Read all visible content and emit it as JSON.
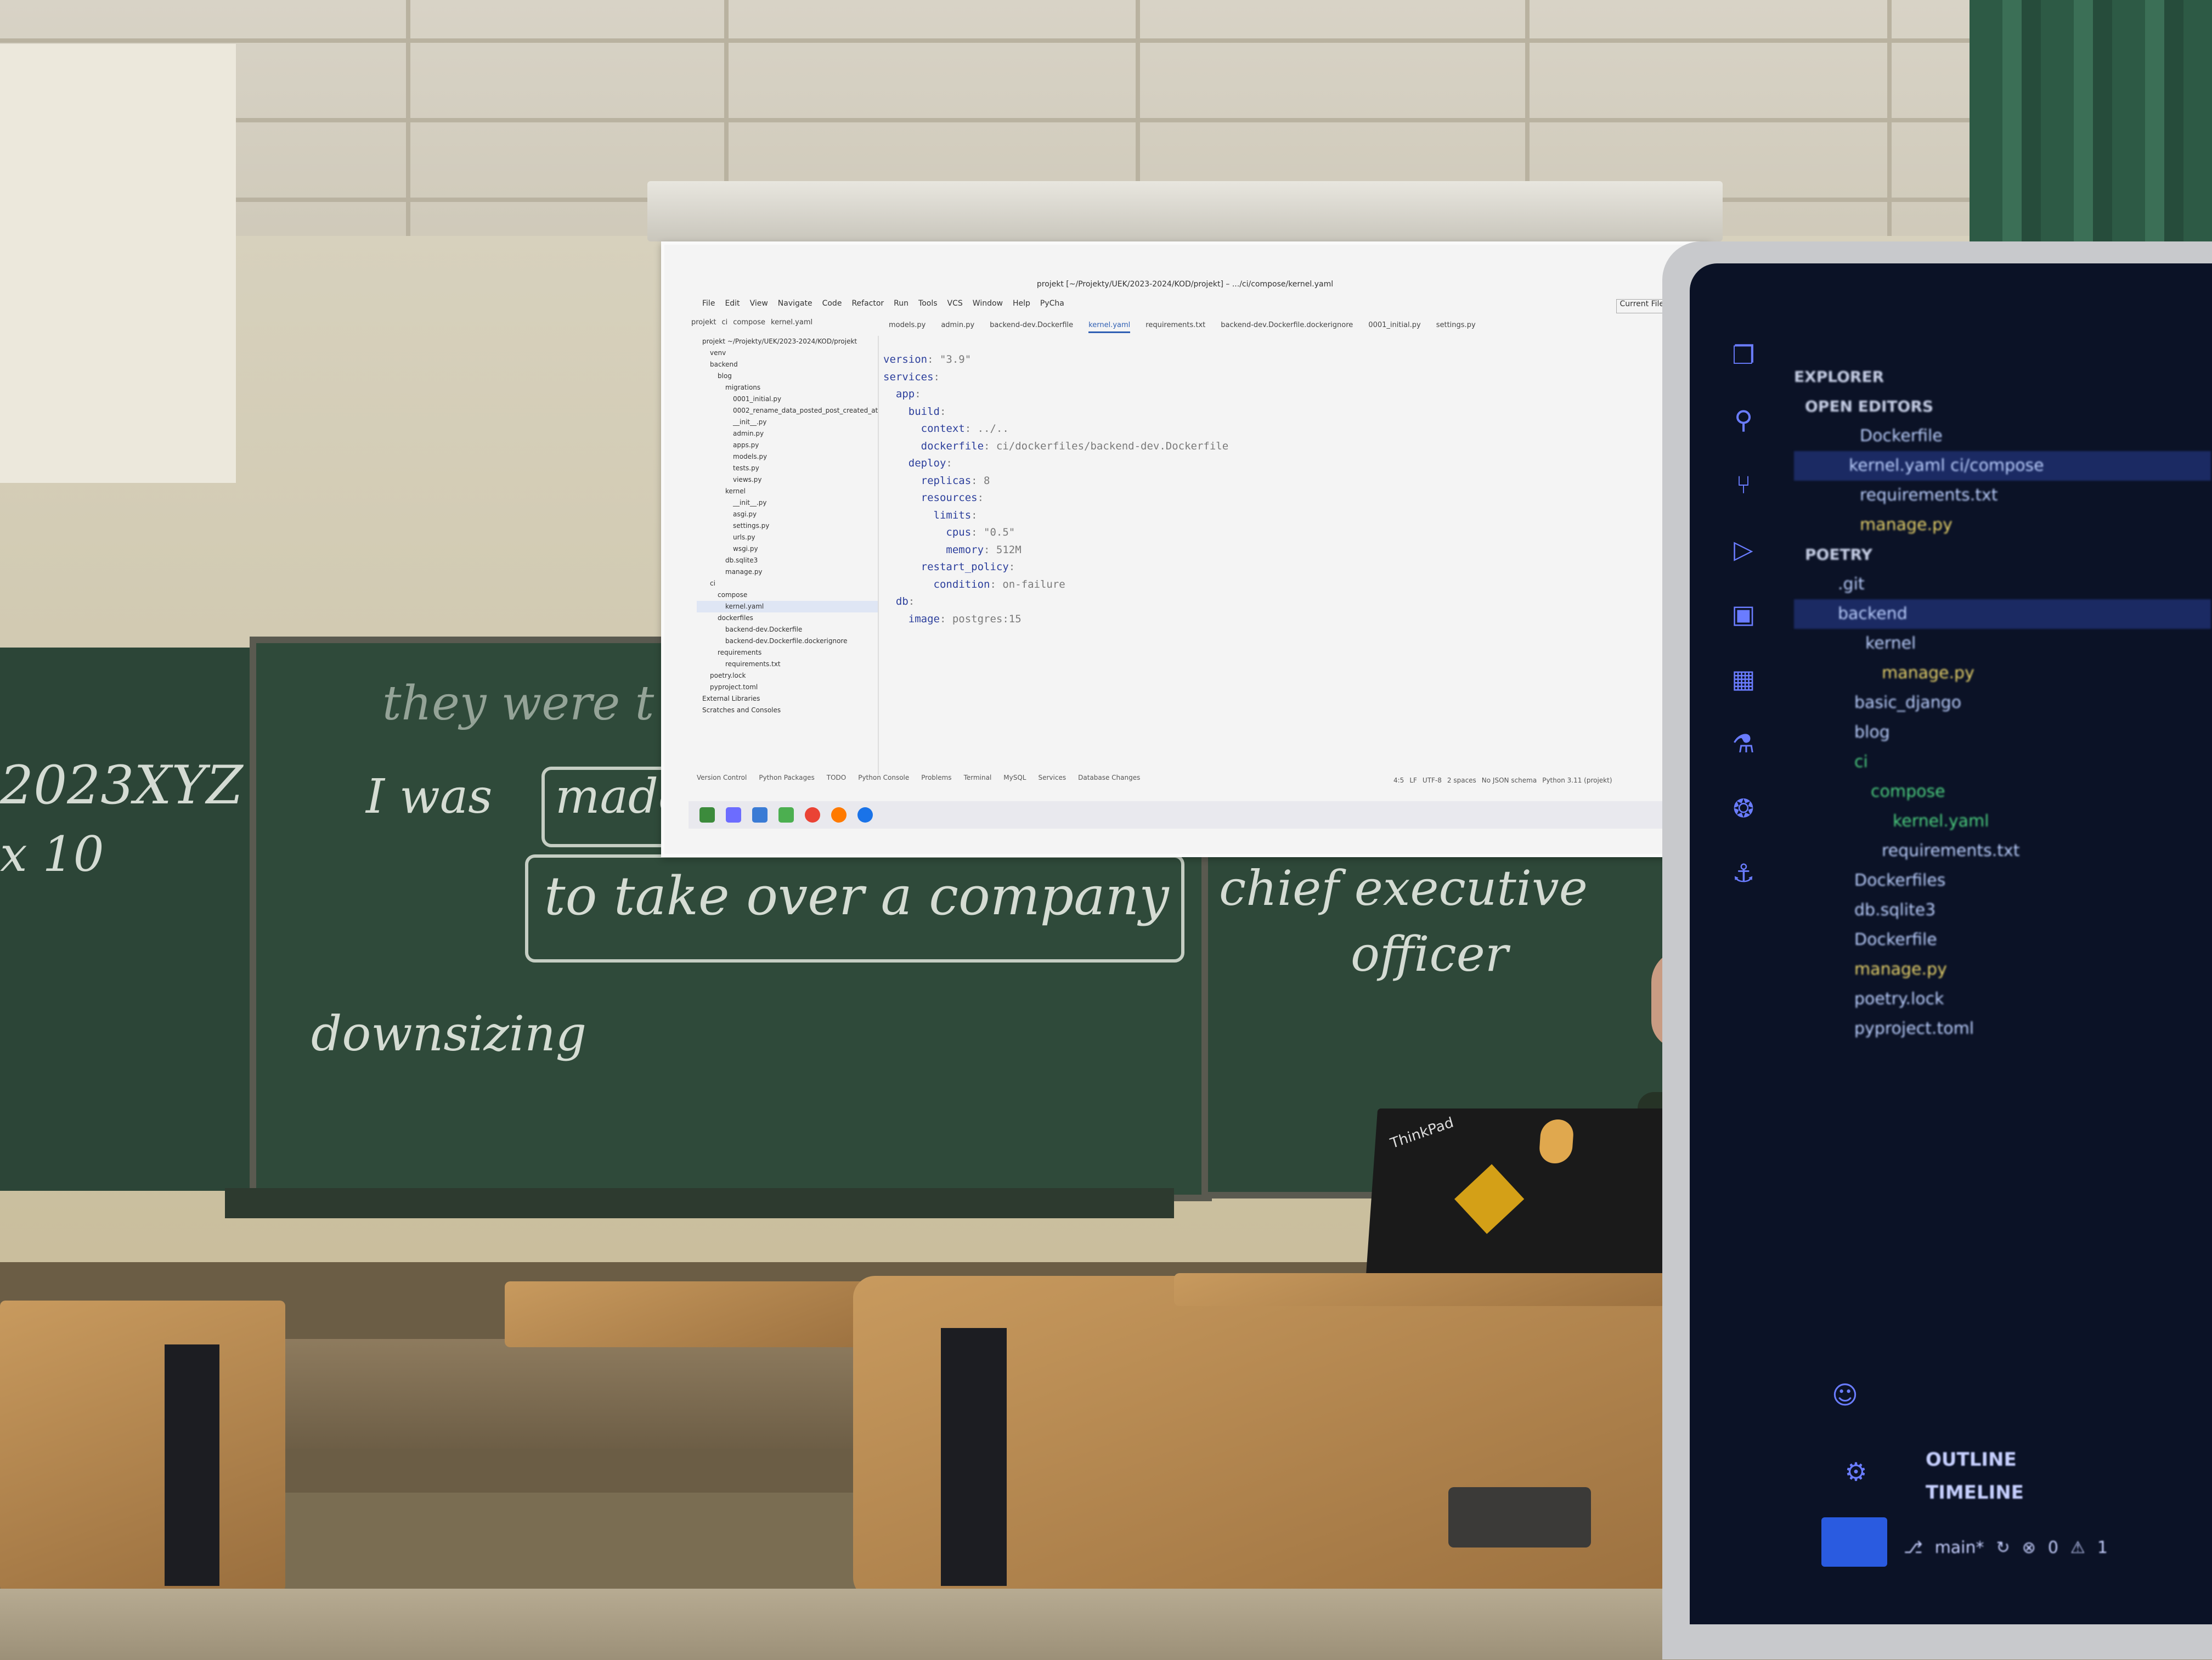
{
  "ide": {
    "title": "projekt [~/Projekty/UEK/2023-2024/KOD/projekt] – .../ci/compose/kernel.yaml",
    "menu": [
      "File",
      "Edit",
      "View",
      "Navigate",
      "Code",
      "Refactor",
      "Run",
      "Tools",
      "VCS",
      "Window",
      "Help",
      "PyCha"
    ],
    "breadcrumb": [
      "projekt",
      "ci",
      "compose",
      "kernel.yaml"
    ],
    "run_config": "Current File",
    "tabs": [
      "models.py",
      "admin.py",
      "backend-dev.Dockerfile",
      "kernel.yaml",
      "requirements.txt",
      "backend-dev.Dockerfile.dockerignore",
      "0001_initial.py",
      "settings.py"
    ],
    "active_tab": "kernel.yaml",
    "project_tree": [
      "projekt  ~/Projekty/UEK/2023-2024/KOD/projekt",
      "venv",
      "backend",
      "blog",
      "migrations",
      "0001_initial.py",
      "0002_rename_data_posted_post_created_at",
      "__init__.py",
      "admin.py",
      "apps.py",
      "models.py",
      "tests.py",
      "views.py",
      "kernel",
      "__init__.py",
      "asgi.py",
      "settings.py",
      "urls.py",
      "wsgi.py",
      "db.sqlite3",
      "manage.py",
      "ci",
      "compose",
      "kernel.yaml",
      "dockerfiles",
      "backend-dev.Dockerfile",
      "backend-dev.Dockerfile.dockerignore",
      "requirements",
      "requirements.txt",
      "poetry.lock",
      "pyproject.toml",
      "External Libraries",
      "Scratches and Consoles"
    ],
    "code_lines": [
      [
        "version",
        ": \"3.9\""
      ],
      [
        "services",
        ":"
      ],
      [
        "  app",
        ":"
      ],
      [
        "    build",
        ":"
      ],
      [
        "      context",
        ": ../.."
      ],
      [
        "      dockerfile",
        ": ci/dockerfiles/backend-dev.Dockerfile"
      ],
      [
        "    deploy",
        ":"
      ],
      [
        "      replicas",
        ": 8"
      ],
      [
        "      resources",
        ":"
      ],
      [
        "        limits",
        ":"
      ],
      [
        "          cpus",
        ": \"0.5\""
      ],
      [
        "          memory",
        ": 512M"
      ],
      [
        "      restart_policy",
        ":"
      ],
      [
        "        condition",
        ": on-failure"
      ],
      [
        "",
        ""
      ],
      [
        "  db",
        ":"
      ],
      [
        "    image",
        ": postgres:15"
      ]
    ],
    "bottom_tools": [
      "Version Control",
      "Python Packages",
      "TODO",
      "Python Console",
      "Problems",
      "Terminal",
      "MySQL",
      "Services",
      "Database Changes"
    ],
    "status": [
      "4:5",
      "LF",
      "UTF-8",
      "2 spaces",
      "No JSON schema",
      "Python 3.11 (projekt)"
    ]
  },
  "chalkboard": {
    "left_line1": "2023XYZ",
    "left_line2": "x 10",
    "line1": "they were t",
    "line2_prefix": "I was",
    "line2_boxed": "made",
    "line3_boxed": "to take over a company",
    "line4": "downsizing",
    "right_line1": "chief executive",
    "right_line2": "officer"
  },
  "vscode": {
    "explorer_title": "EXPLORER",
    "open_editors": "OPEN EDITORS",
    "open_files": [
      "Dockerfile",
      "kernel.yaml  ci/compose",
      "requirements.txt",
      "manage.py"
    ],
    "workspace": "POETRY",
    "tree": [
      ".git",
      "backend",
      "kernel",
      "manage.py",
      "basic_django",
      "blog",
      "ci",
      "compose",
      "kernel.yaml",
      "requirements.txt",
      "Dockerfiles",
      "db.sqlite3",
      "Dockerfile",
      "manage.py",
      "poetry.lock",
      "pyproject.toml"
    ],
    "outline": "OUTLINE",
    "timeline": "TIMELINE",
    "status": [
      "main*",
      "0",
      "1"
    ]
  },
  "laptop_brand": "ThinkPad",
  "colors": {
    "board": "#2f4a3a",
    "yaml_key": "#2c3f9c",
    "vscode_bg": "#0b1226",
    "vscode_accent": "#2a5be0"
  }
}
